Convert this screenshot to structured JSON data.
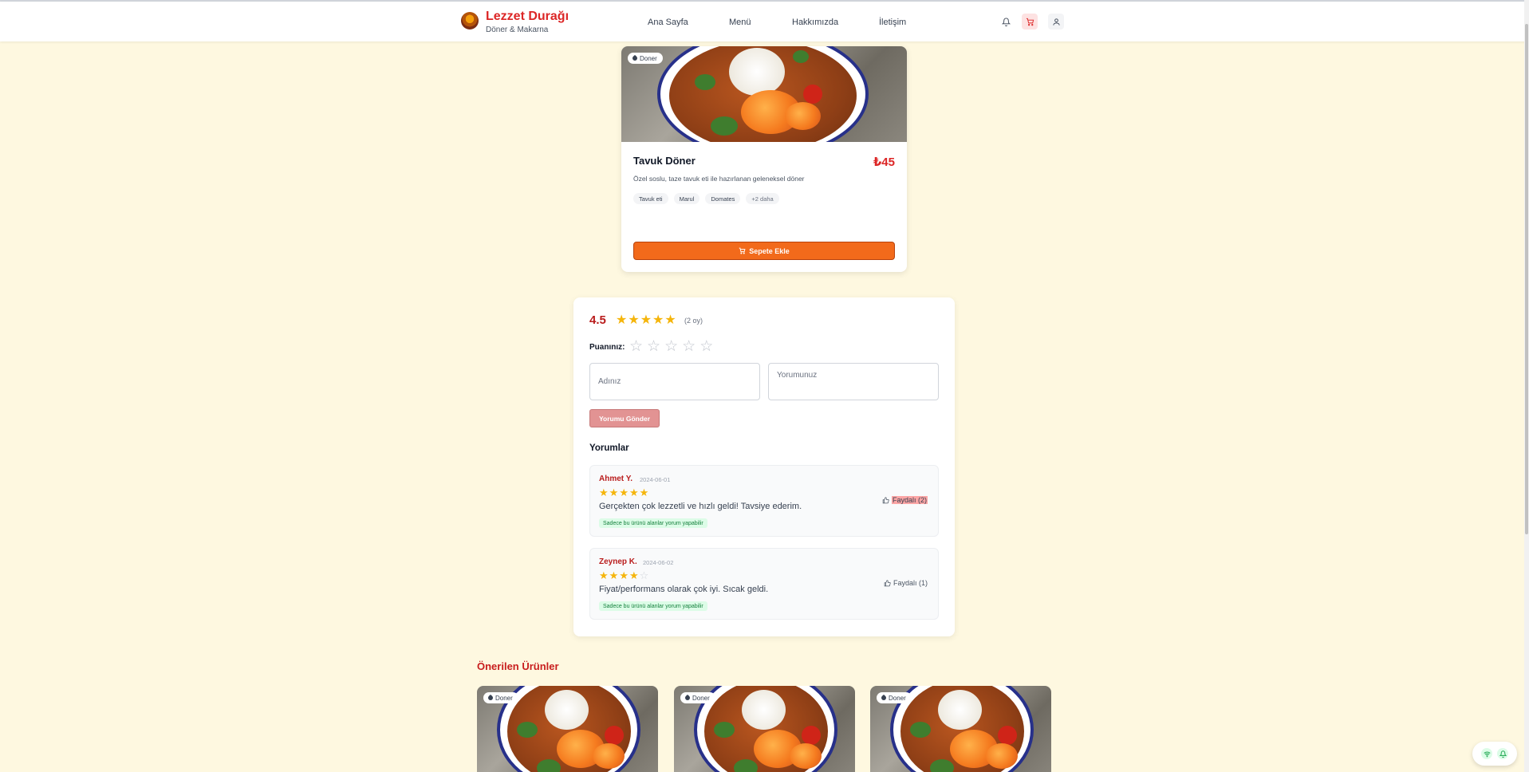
{
  "header": {
    "brand_title": "Lezzet Durağı",
    "brand_subtitle": "Döner & Makarna",
    "nav": [
      "Ana Sayfa",
      "Menü",
      "Hakkımızda",
      "İletişim"
    ],
    "icons": [
      "bell-icon",
      "cart-icon",
      "user-icon"
    ]
  },
  "product": {
    "category_badge": "Doner",
    "name": "Tavuk Döner",
    "price": "₺45",
    "description": "Özel soslu, taze tavuk eti ile hazırlanan geleneksel döner",
    "ingredients": [
      "Tavuk eti",
      "Marul",
      "Domates"
    ],
    "more_label": "+2 daha",
    "add_to_cart_label": "Sepete Ekle"
  },
  "reviews": {
    "average": "4.5",
    "average_value": 4.5,
    "votes_label": "(2 oy)",
    "your_rating_label": "Puanınız:",
    "your_rating_value": 0,
    "name_placeholder": "Adınız",
    "comment_placeholder": "Yorumunuz",
    "submit_label": "Yorumu Gönder",
    "section_title": "Yorumlar",
    "items": [
      {
        "author": "Ahmet Y.",
        "date": "2024-06-01",
        "rating": 5,
        "text": "Gerçekten çok lezzetli ve hızlı geldi! Tavsiye ederim.",
        "badge": "Sadece bu ürünü alanlar yorum yapabilir",
        "helpful_label": "Faydalı (2)"
      },
      {
        "author": "Zeynep K.",
        "date": "2024-06-02",
        "rating": 4,
        "text": "Fiyat/performans olarak çok iyi. Sıcak geldi.",
        "badge": "Sadece bu ürünü alanlar yorum yapabilir",
        "helpful_label": "Faydalı (1)"
      }
    ]
  },
  "suggested": {
    "title": "Önerilen Ürünler",
    "items": [
      {
        "category_badge": "Doner"
      },
      {
        "category_badge": "Doner"
      },
      {
        "category_badge": "Doner"
      }
    ]
  },
  "colors": {
    "brand_red": "#dc2626",
    "accent_orange": "#f26a1b",
    "star_gold": "#f5b50b",
    "page_background": "#fef8e0"
  }
}
